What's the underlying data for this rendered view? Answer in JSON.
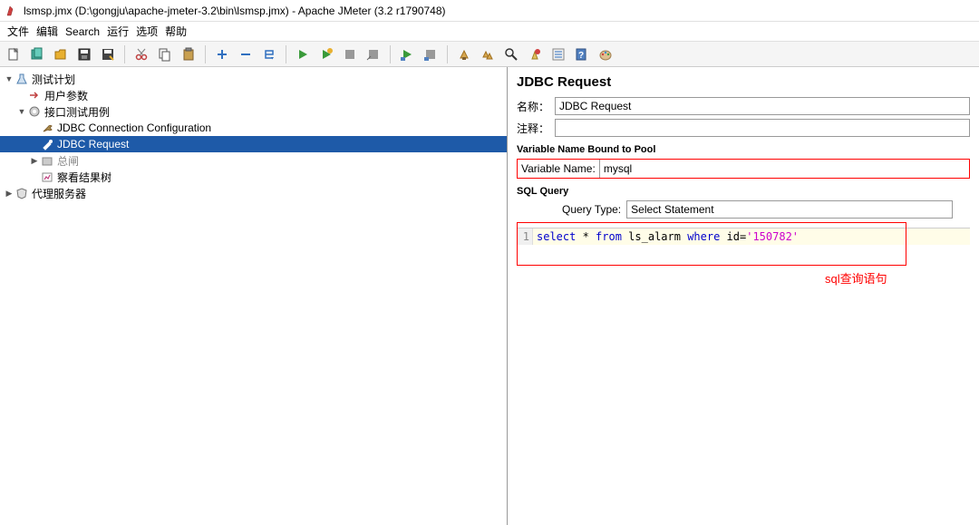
{
  "window": {
    "title": "lsmsp.jmx (D:\\gongju\\apache-jmeter-3.2\\bin\\lsmsp.jmx) - Apache JMeter (3.2 r1790748)"
  },
  "menu": {
    "file": "文件",
    "edit": "编辑",
    "search": "Search",
    "run": "运行",
    "options": "选项",
    "help": "帮助"
  },
  "tree": {
    "root": "测试计划",
    "user_params": "用户参数",
    "test_cases": "接口测试用例",
    "jdbc_conn": "JDBC Connection Configuration",
    "jdbc_req": "JDBC Request",
    "zongzha": "总闸",
    "view_results": "察看结果树",
    "proxy": "代理服务器"
  },
  "panel": {
    "title": "JDBC Request",
    "name_label": "名称：",
    "name_value": "JDBC Request",
    "comment_label": "注释：",
    "comment_value": "",
    "varpool_title": "Variable Name Bound to Pool",
    "varname_label": "Variable Name:",
    "varname_value": "mysql",
    "sqlquery_title": "SQL Query",
    "querytype_label": "Query Type:",
    "querytype_value": "Select Statement",
    "line_no": "1",
    "annotation": "sql查询语句"
  },
  "sql": {
    "kw1": "select",
    "star": " * ",
    "kw2": "from",
    "tbl": " ls_alarm ",
    "kw3": "where",
    "col": " id=",
    "val": "'150782'"
  }
}
